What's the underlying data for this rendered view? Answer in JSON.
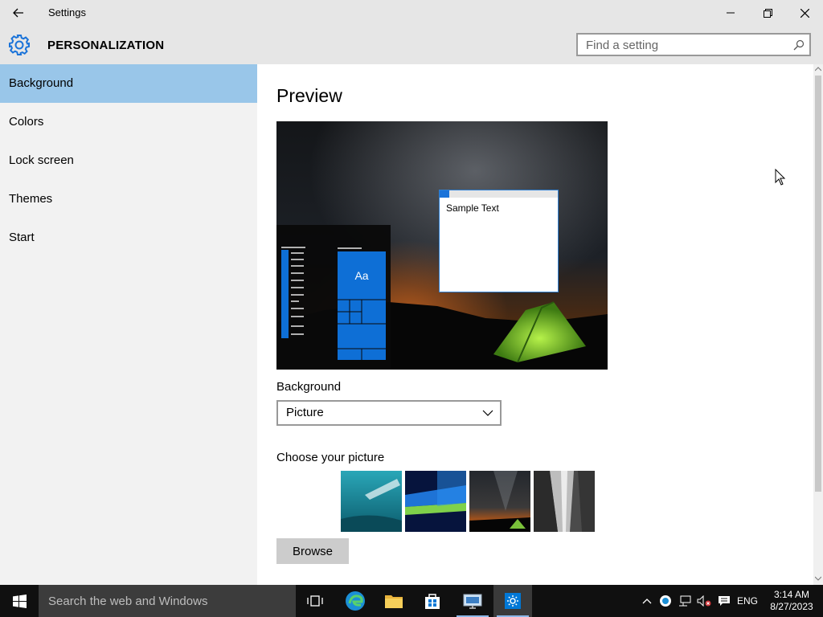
{
  "window": {
    "title": "Settings",
    "header_title": "PERSONALIZATION",
    "search_placeholder": "Find a setting"
  },
  "sidebar": {
    "items": [
      {
        "label": "Background",
        "active": true
      },
      {
        "label": "Colors",
        "active": false
      },
      {
        "label": "Lock screen",
        "active": false
      },
      {
        "label": "Themes",
        "active": false
      },
      {
        "label": "Start",
        "active": false
      }
    ]
  },
  "main": {
    "preview_heading": "Preview",
    "sample_text": "Sample Text",
    "tile_text": "Aa",
    "background_label": "Background",
    "background_value": "Picture",
    "choose_label": "Choose your picture",
    "browse_label": "Browse"
  },
  "taskbar": {
    "search_text": "Search the web and Windows",
    "language": "ENG",
    "time": "3:14 AM",
    "date": "8/27/2023"
  },
  "colors": {
    "accent": "#0078d7",
    "sidebar_active": "#99c6e9",
    "chrome": "#e6e6e6"
  }
}
